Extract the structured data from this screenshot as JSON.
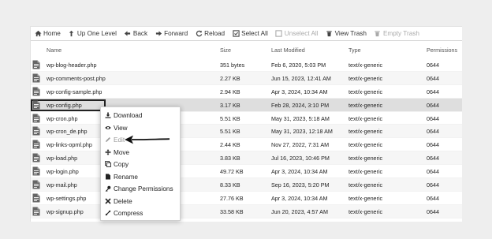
{
  "toolbar": {
    "home": "Home",
    "up_one_level": "Up One Level",
    "back": "Back",
    "forward": "Forward",
    "reload": "Reload",
    "select_all": "Select All",
    "unselect_all": "Unselect All",
    "view_trash": "View Trash",
    "empty_trash": "Empty Trash"
  },
  "columns": {
    "name": "Name",
    "size": "Size",
    "last_modified": "Last Modified",
    "type": "Type",
    "permissions": "Permissions"
  },
  "files": [
    {
      "name": "wp-blog-header.php",
      "size": "351 bytes",
      "modified": "Feb 6, 2020, 5:03 PM",
      "type": "text/x-generic",
      "perm": "0644"
    },
    {
      "name": "wp-comments-post.php",
      "size": "2.27 KB",
      "modified": "Jun 15, 2023, 12:41 AM",
      "type": "text/x-generic",
      "perm": "0644"
    },
    {
      "name": "wp-config-sample.php",
      "size": "2.94 KB",
      "modified": "Apr 3, 2024, 10:34 AM",
      "type": "text/x-generic",
      "perm": "0644"
    },
    {
      "name": "wp-config.php",
      "size": "3.17 KB",
      "modified": "Feb 28, 2024, 3:10 PM",
      "type": "text/x-generic",
      "perm": "0644"
    },
    {
      "name": "wp-cron.php",
      "size": "5.51 KB",
      "modified": "May 31, 2023, 5:18 AM",
      "type": "text/x-generic",
      "perm": "0644"
    },
    {
      "name": "wp-cron_de.php",
      "size": "5.51 KB",
      "modified": "May 31, 2023, 12:18 AM",
      "type": "text/x-generic",
      "perm": "0644"
    },
    {
      "name": "wp-links-opml.php",
      "size": "2.44 KB",
      "modified": "Nov 27, 2022, 7:31 AM",
      "type": "text/x-generic",
      "perm": "0644"
    },
    {
      "name": "wp-load.php",
      "size": "3.83 KB",
      "modified": "Jul 16, 2023, 10:46 PM",
      "type": "text/x-generic",
      "perm": "0644"
    },
    {
      "name": "wp-login.php",
      "size": "49.72 KB",
      "modified": "Apr 3, 2024, 10:34 AM",
      "type": "text/x-generic",
      "perm": "0644"
    },
    {
      "name": "wp-mail.php",
      "size": "8.33 KB",
      "modified": "Sep 16, 2023, 5:20 PM",
      "type": "text/x-generic",
      "perm": "0644"
    },
    {
      "name": "wp-settings.php",
      "size": "27.76 KB",
      "modified": "Apr 3, 2024, 10:34 AM",
      "type": "text/x-generic",
      "perm": "0644"
    },
    {
      "name": "wp-signup.php",
      "size": "33.58 KB",
      "modified": "Jun 20, 2023, 4:57 AM",
      "type": "text/x-generic",
      "perm": "0644"
    }
  ],
  "context_menu": {
    "download": "Download",
    "view": "View",
    "edit": "Edit",
    "move": "Move",
    "copy": "Copy",
    "rename": "Rename",
    "change_permissions": "Change Permissions",
    "delete": "Delete",
    "compress": "Compress"
  },
  "colors": {
    "selected_row": "#dedede",
    "highlight_border": "#222222",
    "disabled_text": "#aaaaaa"
  }
}
